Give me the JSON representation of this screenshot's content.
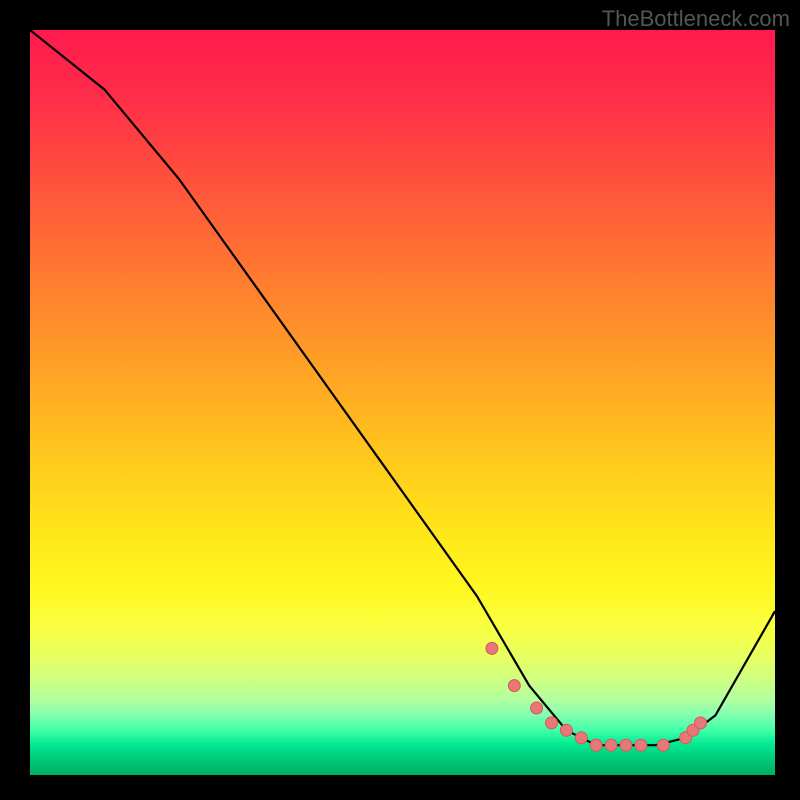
{
  "watermark": "TheBottleneck.com",
  "chart_data": {
    "type": "line",
    "title": "",
    "xlabel": "",
    "ylabel": "",
    "xlim": [
      0,
      100
    ],
    "ylim": [
      0,
      100
    ],
    "series": [
      {
        "name": "curve",
        "x": [
          0,
          10,
          20,
          30,
          40,
          50,
          60,
          67,
          72,
          76,
          80,
          84,
          88,
          92,
          100
        ],
        "values": [
          100,
          92,
          80,
          66,
          52,
          38,
          24,
          12,
          6,
          4,
          4,
          4,
          5,
          8,
          22
        ]
      }
    ],
    "markers": {
      "x": [
        62,
        65,
        68,
        70,
        72,
        74,
        76,
        78,
        80,
        82,
        85,
        88,
        89,
        90
      ],
      "values": [
        17,
        12,
        9,
        7,
        6,
        5,
        4,
        4,
        4,
        4,
        4,
        5,
        6,
        7
      ]
    },
    "colors": {
      "curve": "#000000",
      "marker_fill": "#e87878",
      "marker_stroke": "#d85858"
    }
  }
}
